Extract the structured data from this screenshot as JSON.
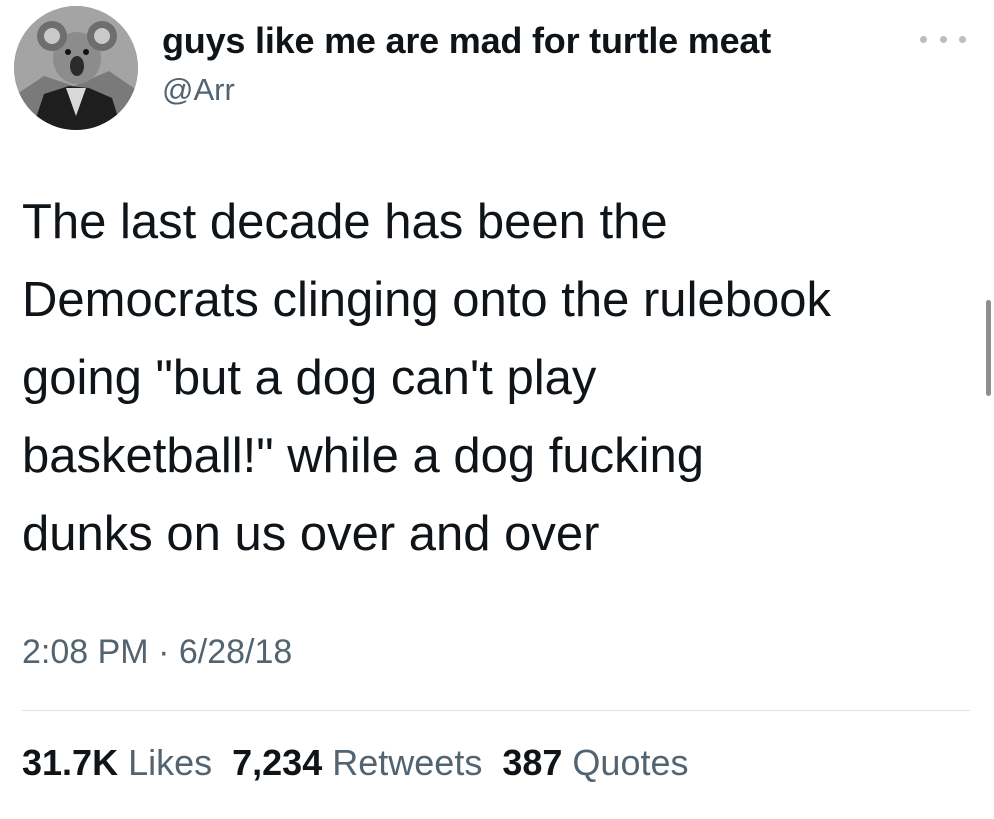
{
  "author": {
    "display_name": "guys like me are mad for turtle meat",
    "handle": "@Arr",
    "avatar_icon": "koala-in-leather-jacket-avatar"
  },
  "tweet": {
    "text_lines": [
      "The last decade has been the",
      "Democrats clinging onto the rulebook",
      "going \"but a dog can't play",
      "basketball!\" while a dog fucking",
      "dunks on us over and over"
    ],
    "timestamp": "2:08 PM · 6/28/18"
  },
  "stats": {
    "likes_count": "31.7K",
    "likes_label": "Likes",
    "retweets_count": "7,234",
    "retweets_label": "Retweets",
    "quotes_count": "387",
    "quotes_label": "Quotes"
  },
  "icons": {
    "more": "more-horizontal-icon"
  },
  "colors": {
    "text_primary": "#0f1419",
    "text_secondary": "#536471",
    "divider": "#dfe3e6",
    "background": "#ffffff"
  }
}
